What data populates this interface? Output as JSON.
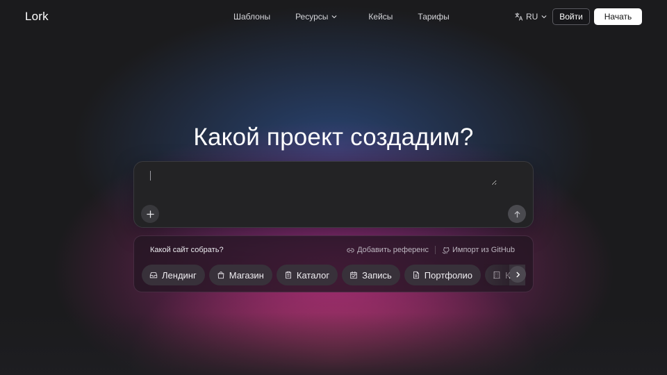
{
  "header": {
    "logo": "Lork",
    "nav": [
      {
        "label": "Шаблоны",
        "has_dropdown": false
      },
      {
        "label": "Ресурсы",
        "has_dropdown": true
      },
      {
        "label": "Кейсы",
        "has_dropdown": false
      },
      {
        "label": "Тарифы",
        "has_dropdown": false
      }
    ],
    "language": {
      "label": "RU",
      "icon": "translate-icon"
    },
    "login_label": "Войти",
    "start_label": "Начать"
  },
  "hero": {
    "title": "Какой проект создадим?"
  },
  "prompt": {
    "value": "",
    "placeholder": "",
    "attach_icon": "plus-icon",
    "send_icon": "arrow-up-icon"
  },
  "suggestions": {
    "title": "Какой сайт собрать?",
    "add_reference_label": "Добавить референс",
    "import_label": "Импорт из GitHub",
    "chips": [
      {
        "label": "Лендинг",
        "icon": "inbox-icon"
      },
      {
        "label": "Магазин",
        "icon": "shopping-bag-icon"
      },
      {
        "label": "Каталог",
        "icon": "clipboard-icon"
      },
      {
        "label": "Запись",
        "icon": "calendar-icon"
      },
      {
        "label": "Портфолио",
        "icon": "file-icon"
      },
      {
        "label": "Корпоративный",
        "icon": "building-icon"
      }
    ],
    "next_icon": "chevron-right-icon"
  },
  "colors": {
    "primary_button": "#ffffff",
    "panel": "#232325",
    "glow_pink": "#be288c",
    "glow_blue": "#2d508c"
  }
}
